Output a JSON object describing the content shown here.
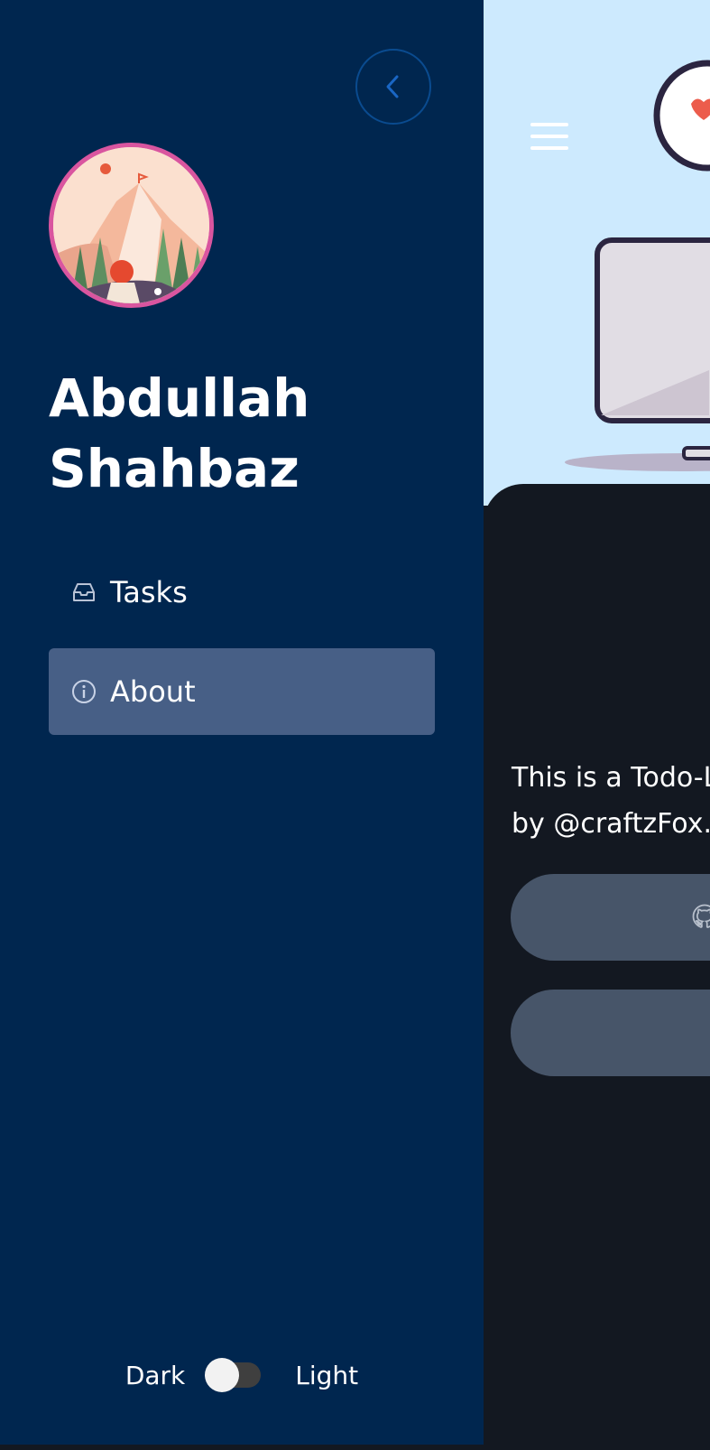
{
  "drawer": {
    "user_name": "Abdullah Shahbaz",
    "nav_items": [
      {
        "label": "Tasks",
        "icon": "inbox-icon",
        "active": false
      },
      {
        "label": "About",
        "icon": "info-icon",
        "active": true
      }
    ],
    "theme_toggle": {
      "left_label": "Dark",
      "right_label": "Light",
      "state": "dark"
    }
  },
  "main": {
    "description_line1": "This is a Todo-L",
    "description_line2": "by @craftzFox.",
    "buttons": [
      {
        "name": "github-button",
        "icon": "github-icon"
      },
      {
        "name": "secondary-button"
      }
    ]
  },
  "colors": {
    "drawer_bg": "#00264f",
    "active_item_bg": "#475f86",
    "header_bg": "#cdeafe",
    "content_bg": "#131821",
    "button_bg": "#475569",
    "avatar_border": "#d9559f"
  }
}
